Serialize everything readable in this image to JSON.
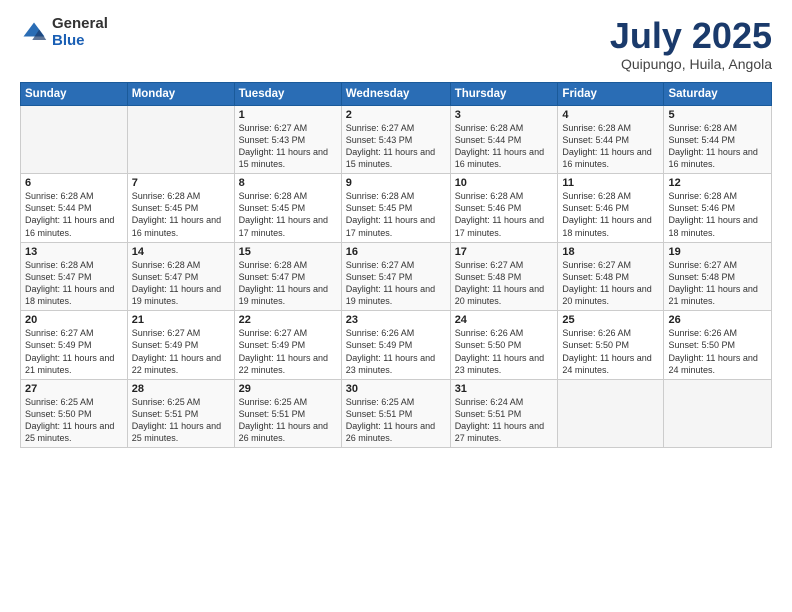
{
  "logo": {
    "general": "General",
    "blue": "Blue"
  },
  "title": {
    "month": "July 2025",
    "location": "Quipungo, Huila, Angola"
  },
  "weekdays": [
    "Sunday",
    "Monday",
    "Tuesday",
    "Wednesday",
    "Thursday",
    "Friday",
    "Saturday"
  ],
  "weeks": [
    [
      {
        "day": "",
        "sunrise": "",
        "sunset": "",
        "daylight": ""
      },
      {
        "day": "",
        "sunrise": "",
        "sunset": "",
        "daylight": ""
      },
      {
        "day": "1",
        "sunrise": "Sunrise: 6:27 AM",
        "sunset": "Sunset: 5:43 PM",
        "daylight": "Daylight: 11 hours and 15 minutes."
      },
      {
        "day": "2",
        "sunrise": "Sunrise: 6:27 AM",
        "sunset": "Sunset: 5:43 PM",
        "daylight": "Daylight: 11 hours and 15 minutes."
      },
      {
        "day": "3",
        "sunrise": "Sunrise: 6:28 AM",
        "sunset": "Sunset: 5:44 PM",
        "daylight": "Daylight: 11 hours and 16 minutes."
      },
      {
        "day": "4",
        "sunrise": "Sunrise: 6:28 AM",
        "sunset": "Sunset: 5:44 PM",
        "daylight": "Daylight: 11 hours and 16 minutes."
      },
      {
        "day": "5",
        "sunrise": "Sunrise: 6:28 AM",
        "sunset": "Sunset: 5:44 PM",
        "daylight": "Daylight: 11 hours and 16 minutes."
      }
    ],
    [
      {
        "day": "6",
        "sunrise": "Sunrise: 6:28 AM",
        "sunset": "Sunset: 5:44 PM",
        "daylight": "Daylight: 11 hours and 16 minutes."
      },
      {
        "day": "7",
        "sunrise": "Sunrise: 6:28 AM",
        "sunset": "Sunset: 5:45 PM",
        "daylight": "Daylight: 11 hours and 16 minutes."
      },
      {
        "day": "8",
        "sunrise": "Sunrise: 6:28 AM",
        "sunset": "Sunset: 5:45 PM",
        "daylight": "Daylight: 11 hours and 17 minutes."
      },
      {
        "day": "9",
        "sunrise": "Sunrise: 6:28 AM",
        "sunset": "Sunset: 5:45 PM",
        "daylight": "Daylight: 11 hours and 17 minutes."
      },
      {
        "day": "10",
        "sunrise": "Sunrise: 6:28 AM",
        "sunset": "Sunset: 5:46 PM",
        "daylight": "Daylight: 11 hours and 17 minutes."
      },
      {
        "day": "11",
        "sunrise": "Sunrise: 6:28 AM",
        "sunset": "Sunset: 5:46 PM",
        "daylight": "Daylight: 11 hours and 18 minutes."
      },
      {
        "day": "12",
        "sunrise": "Sunrise: 6:28 AM",
        "sunset": "Sunset: 5:46 PM",
        "daylight": "Daylight: 11 hours and 18 minutes."
      }
    ],
    [
      {
        "day": "13",
        "sunrise": "Sunrise: 6:28 AM",
        "sunset": "Sunset: 5:47 PM",
        "daylight": "Daylight: 11 hours and 18 minutes."
      },
      {
        "day": "14",
        "sunrise": "Sunrise: 6:28 AM",
        "sunset": "Sunset: 5:47 PM",
        "daylight": "Daylight: 11 hours and 19 minutes."
      },
      {
        "day": "15",
        "sunrise": "Sunrise: 6:28 AM",
        "sunset": "Sunset: 5:47 PM",
        "daylight": "Daylight: 11 hours and 19 minutes."
      },
      {
        "day": "16",
        "sunrise": "Sunrise: 6:27 AM",
        "sunset": "Sunset: 5:47 PM",
        "daylight": "Daylight: 11 hours and 19 minutes."
      },
      {
        "day": "17",
        "sunrise": "Sunrise: 6:27 AM",
        "sunset": "Sunset: 5:48 PM",
        "daylight": "Daylight: 11 hours and 20 minutes."
      },
      {
        "day": "18",
        "sunrise": "Sunrise: 6:27 AM",
        "sunset": "Sunset: 5:48 PM",
        "daylight": "Daylight: 11 hours and 20 minutes."
      },
      {
        "day": "19",
        "sunrise": "Sunrise: 6:27 AM",
        "sunset": "Sunset: 5:48 PM",
        "daylight": "Daylight: 11 hours and 21 minutes."
      }
    ],
    [
      {
        "day": "20",
        "sunrise": "Sunrise: 6:27 AM",
        "sunset": "Sunset: 5:49 PM",
        "daylight": "Daylight: 11 hours and 21 minutes."
      },
      {
        "day": "21",
        "sunrise": "Sunrise: 6:27 AM",
        "sunset": "Sunset: 5:49 PM",
        "daylight": "Daylight: 11 hours and 22 minutes."
      },
      {
        "day": "22",
        "sunrise": "Sunrise: 6:27 AM",
        "sunset": "Sunset: 5:49 PM",
        "daylight": "Daylight: 11 hours and 22 minutes."
      },
      {
        "day": "23",
        "sunrise": "Sunrise: 6:26 AM",
        "sunset": "Sunset: 5:49 PM",
        "daylight": "Daylight: 11 hours and 23 minutes."
      },
      {
        "day": "24",
        "sunrise": "Sunrise: 6:26 AM",
        "sunset": "Sunset: 5:50 PM",
        "daylight": "Daylight: 11 hours and 23 minutes."
      },
      {
        "day": "25",
        "sunrise": "Sunrise: 6:26 AM",
        "sunset": "Sunset: 5:50 PM",
        "daylight": "Daylight: 11 hours and 24 minutes."
      },
      {
        "day": "26",
        "sunrise": "Sunrise: 6:26 AM",
        "sunset": "Sunset: 5:50 PM",
        "daylight": "Daylight: 11 hours and 24 minutes."
      }
    ],
    [
      {
        "day": "27",
        "sunrise": "Sunrise: 6:25 AM",
        "sunset": "Sunset: 5:50 PM",
        "daylight": "Daylight: 11 hours and 25 minutes."
      },
      {
        "day": "28",
        "sunrise": "Sunrise: 6:25 AM",
        "sunset": "Sunset: 5:51 PM",
        "daylight": "Daylight: 11 hours and 25 minutes."
      },
      {
        "day": "29",
        "sunrise": "Sunrise: 6:25 AM",
        "sunset": "Sunset: 5:51 PM",
        "daylight": "Daylight: 11 hours and 26 minutes."
      },
      {
        "day": "30",
        "sunrise": "Sunrise: 6:25 AM",
        "sunset": "Sunset: 5:51 PM",
        "daylight": "Daylight: 11 hours and 26 minutes."
      },
      {
        "day": "31",
        "sunrise": "Sunrise: 6:24 AM",
        "sunset": "Sunset: 5:51 PM",
        "daylight": "Daylight: 11 hours and 27 minutes."
      },
      {
        "day": "",
        "sunrise": "",
        "sunset": "",
        "daylight": ""
      },
      {
        "day": "",
        "sunrise": "",
        "sunset": "",
        "daylight": ""
      }
    ]
  ]
}
